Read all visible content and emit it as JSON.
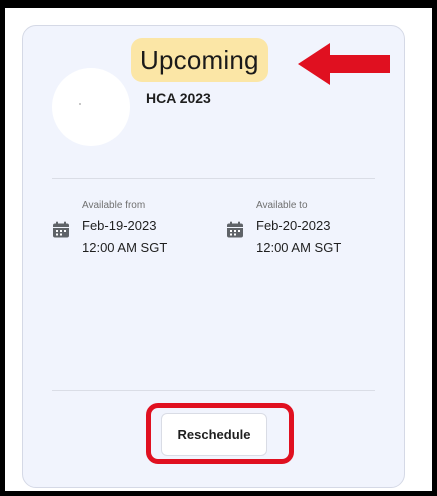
{
  "card": {
    "status": "Upcoming",
    "exam_title": "HCA 2023",
    "available_from": {
      "caption": "Available from",
      "date": "Feb-19-2023",
      "time": "12:00 AM SGT"
    },
    "available_to": {
      "caption": "Available to",
      "date": "Feb-20-2023",
      "time": "12:00 AM SGT"
    },
    "reschedule_label": "Reschedule"
  },
  "icons": {
    "calendar": "calendar-icon",
    "annotation_arrow": "arrow-left-icon"
  },
  "colors": {
    "card_background": "#f1f4fd",
    "badge_background": "#fbe6a6",
    "annotation_red": "#e01020",
    "icon_gray": "#5f6368"
  }
}
